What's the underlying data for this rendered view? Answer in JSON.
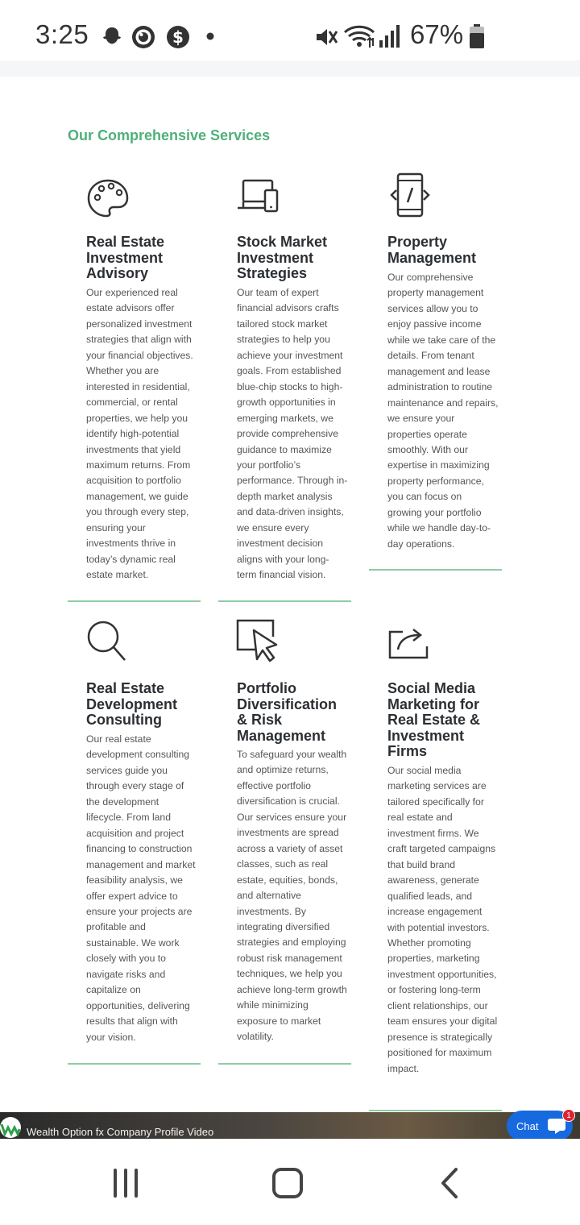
{
  "status_bar": {
    "time": "3:25",
    "battery": "67%",
    "icons": [
      "snapchat-icon",
      "target-icon",
      "dollar-icon",
      "dot-icon",
      "mute-icon",
      "wifi-icon",
      "signal-icon",
      "battery-icon"
    ]
  },
  "section_title": "Our Comprehensive Services",
  "services": [
    {
      "icon": "palette-icon",
      "title": "Real Estate Investment Advisory",
      "text": "Our experienced real estate advisors offer personalized investment strategies that align with your financial objectives. Whether you are interested in residential, commercial, or rental properties, we help you identify high-potential investments that yield maximum returns. From acquisition to portfolio management, we guide you through every step, ensuring your investments thrive in today’s dynamic real estate market."
    },
    {
      "icon": "devices-icon",
      "title": "Stock Market Investment Strategies",
      "text": "Our team of expert financial advisors crafts tailored stock market strategies to help you achieve your investment goals. From established blue-chip stocks to high-growth opportunities in emerging markets, we provide comprehensive guidance to maximize your portfolio’s performance. Through in-depth market analysis and data-driven insights, we ensure every investment decision aligns with your long-term financial vision."
    },
    {
      "icon": "mobile-code-icon",
      "title": "Property Management",
      "text": "Our comprehensive property management services allow you to enjoy passive income while we take care of the details. From tenant management and lease administration to routine maintenance and repairs, we ensure your properties operate smoothly. With our expertise in maximizing property performance, you can focus on growing your portfolio while we handle day-to-day operations."
    },
    {
      "icon": "search-icon",
      "title": "Real Estate Development Consulting",
      "text": "Our real estate development consulting services guide you through every stage of the development lifecycle. From land acquisition and project financing to construction management and market feasibility analysis, we offer expert advice to ensure your projects are profitable and sustainable. We work closely with you to navigate risks and capitalize on opportunities, delivering results that align with your vision."
    },
    {
      "icon": "cursor-icon",
      "title": "Portfolio Diversification & Risk Management",
      "text": "To safeguard your wealth and optimize returns, effective portfolio diversification is crucial. Our services ensure your investments are spread across a variety of asset classes, such as real estate, equities, bonds, and alternative investments. By integrating diversified strategies and employing robust risk management techniques, we help you achieve long-term growth while minimizing exposure to market volatility."
    },
    {
      "icon": "share-icon",
      "title": "Social Media Marketing for Real Estate & Investment Firms",
      "text": "Our social media marketing services are tailored specifically for real estate and investment firms. We craft targeted campaigns that build brand awareness, generate qualified leads, and increase engagement with potential investors. Whether promoting properties, marketing investment opportunities, or fostering long-term client relationships, our team ensures your digital presence is strategically positioned for maximum impact."
    }
  ],
  "video": {
    "title": "Wealth Option fx Company Profile Video"
  },
  "chat": {
    "label": "Chat",
    "badge": "1"
  },
  "nav": {
    "icons": [
      "recent-apps-icon",
      "home-icon",
      "back-icon"
    ]
  },
  "colors": {
    "accent": "#4fb07a",
    "rule": "#8fcca6",
    "chat": "#1769e0",
    "badge": "#e0232e"
  }
}
